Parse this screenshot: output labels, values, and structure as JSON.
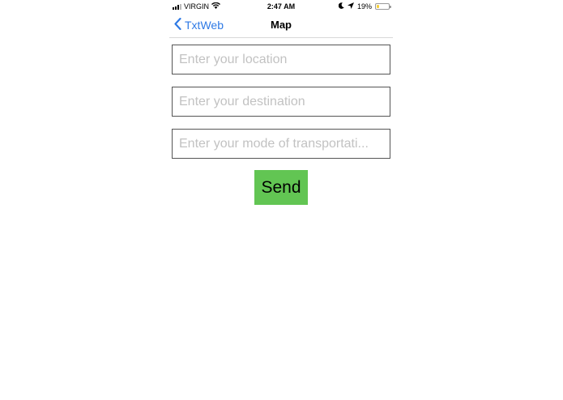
{
  "status_bar": {
    "carrier": "VIRGIN",
    "time": "2:47 AM",
    "battery_percent": "19%",
    "battery_level": 0.19
  },
  "nav": {
    "back_label": "TxtWeb",
    "title": "Map"
  },
  "form": {
    "location_placeholder": "Enter your location",
    "destination_placeholder": "Enter your destination",
    "mode_placeholder": "Enter your mode of transportati...",
    "send_label": "Send"
  },
  "colors": {
    "accent": "#2f7ae5",
    "send_button": "#62c553",
    "battery": "#f5cf3b"
  },
  "icons": [
    "signal-icon",
    "wifi-icon",
    "moon-icon",
    "location-arrow-icon",
    "battery-icon",
    "chevron-left-icon"
  ]
}
